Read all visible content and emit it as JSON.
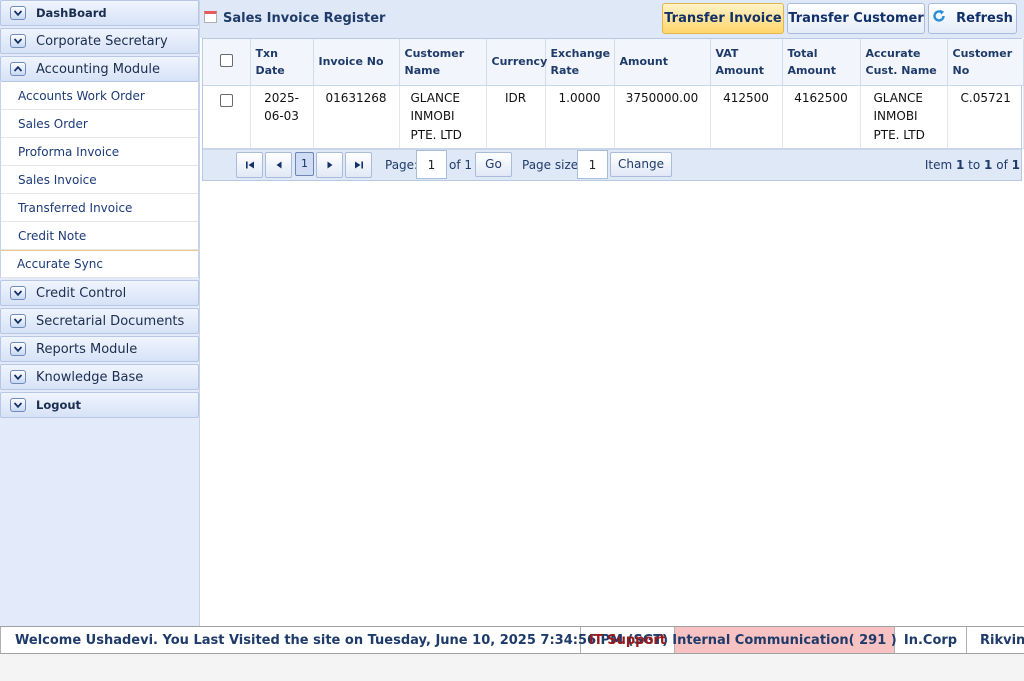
{
  "sidebar": {
    "headers": [
      {
        "label": "DashBoard",
        "icon": "chevron-down-icon"
      },
      {
        "label": "Corporate Secretary",
        "icon": "chevron-down-icon"
      },
      {
        "label": "Accounting Module",
        "icon": "chevron-up-icon"
      }
    ],
    "accounting_items": [
      {
        "label": "Accounts Work Order"
      },
      {
        "label": "Sales Order"
      },
      {
        "label": "Proforma Invoice"
      },
      {
        "label": "Sales Invoice"
      },
      {
        "label": "Transferred Invoice"
      },
      {
        "label": "Credit Note"
      },
      {
        "label": "Accurate Sync"
      }
    ],
    "more_headers": [
      {
        "label": "Credit Control"
      },
      {
        "label": "Secretarial Documents"
      },
      {
        "label": "Reports Module"
      },
      {
        "label": "Knowledge Base"
      },
      {
        "label": "Logout"
      }
    ]
  },
  "header": {
    "title": "Sales Invoice Register",
    "transfer_invoice": "Transfer Invoice",
    "transfer_customer": "Transfer Customer",
    "refresh": "Refresh"
  },
  "grid": {
    "columns": [
      "Txn Date",
      "Invoice No",
      "Customer Name",
      "Currency",
      "Exchange Rate",
      "Amount",
      "VAT Amount",
      "Total Amount",
      "Accurate Cust. Name",
      "Customer No"
    ],
    "rows": [
      {
        "txn_date": "2025-06-03",
        "invoice_no": "01631268",
        "customer_name": "GLANCE INMOBI PTE. LTD",
        "currency": "IDR",
        "exchange_rate": "1.0000",
        "amount": "3750000.00",
        "vat_amount": "412500",
        "total_amount": "4162500",
        "accurate_cust_name": "GLANCE INMOBI PTE. LTD",
        "customer_no": "C.05721"
      }
    ]
  },
  "pager": {
    "current_page": "1",
    "page_label": "Page:",
    "page_value": "1",
    "of_label": "of 1",
    "go_label": "Go",
    "size_label": "Page size:",
    "size_value": "1",
    "change_label": "Change",
    "info_prefix": "Item",
    "info_from": "1",
    "info_to_word": "to",
    "info_to": "1",
    "info_of_word": "of",
    "info_total": "1"
  },
  "statusbar": {
    "welcome": "Welcome Ushadevi. You Last Visited the site on Tuesday, June 10, 2025 7:34:56 PM (SGT)",
    "it_support": "IT Support",
    "internal_comm": "Internal Communication( 291 )",
    "incorp": "In.Corp",
    "rikvin": "Rikvin"
  },
  "colors": {
    "accent_yellow": "#ffd66a",
    "highlight_pink": "#f9c2c2",
    "nav_blue": "#1c3a78"
  }
}
